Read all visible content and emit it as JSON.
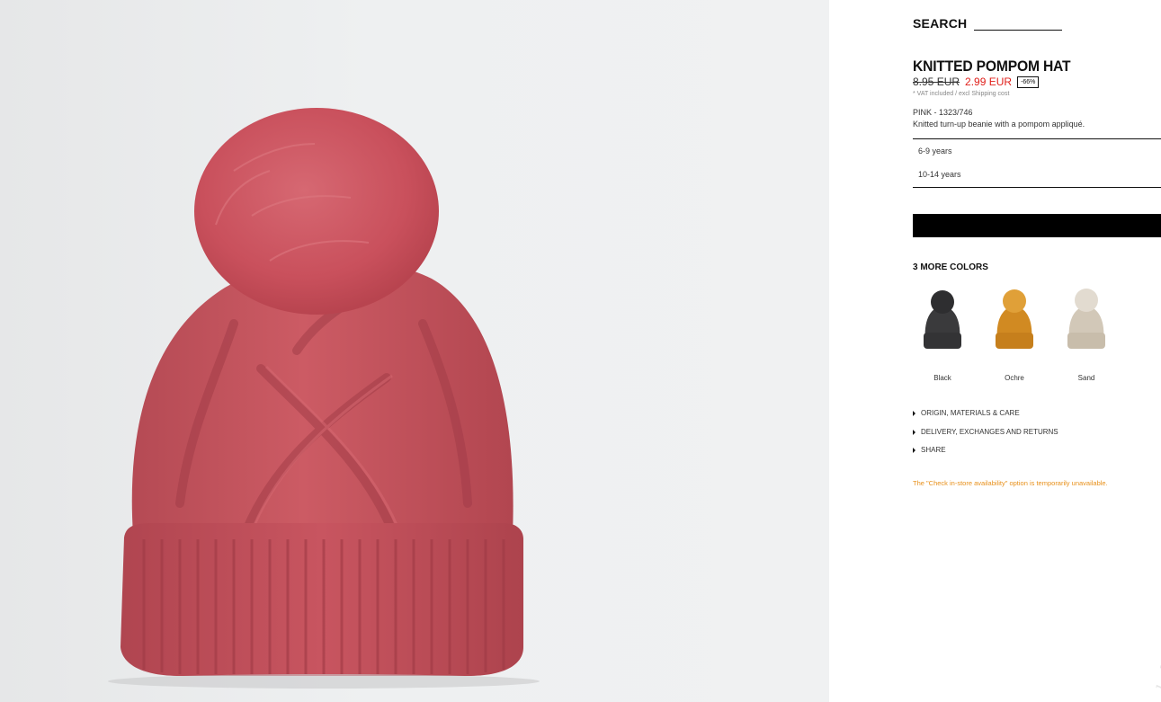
{
  "search": {
    "label": "SEARCH"
  },
  "product": {
    "title": "KNITTED POMPOM HAT",
    "old_price": "8.95 EUR",
    "new_price": "2.99 EUR",
    "discount": "-66%",
    "vat_note": "* VAT included / excl Shipping cost",
    "color_ref": "PINK - 1323/746",
    "description": "Knitted turn-up beanie with a pompom appliqué.",
    "hero_color": "#c95560"
  },
  "sizes": [
    {
      "label": "6-9 years"
    },
    {
      "label": "10-14 years"
    }
  ],
  "add_button": {
    "label": ""
  },
  "more_colors": {
    "heading": "3 MORE COLORS",
    "items": [
      {
        "name": "Black",
        "color": "#3a3a3c"
      },
      {
        "name": "Ochre",
        "color": "#d18a22"
      },
      {
        "name": "Sand",
        "color": "#d2c8b8"
      }
    ]
  },
  "accordions": [
    {
      "label": "ORIGIN, MATERIALS & CARE"
    },
    {
      "label": "DELIVERY, EXCHANGES AND RETURNS"
    },
    {
      "label": "SHARE"
    }
  ],
  "notice": "The \"Check in-store availability\" option is temporarily unavailable.",
  "watermark": "ladies.zp.ua"
}
